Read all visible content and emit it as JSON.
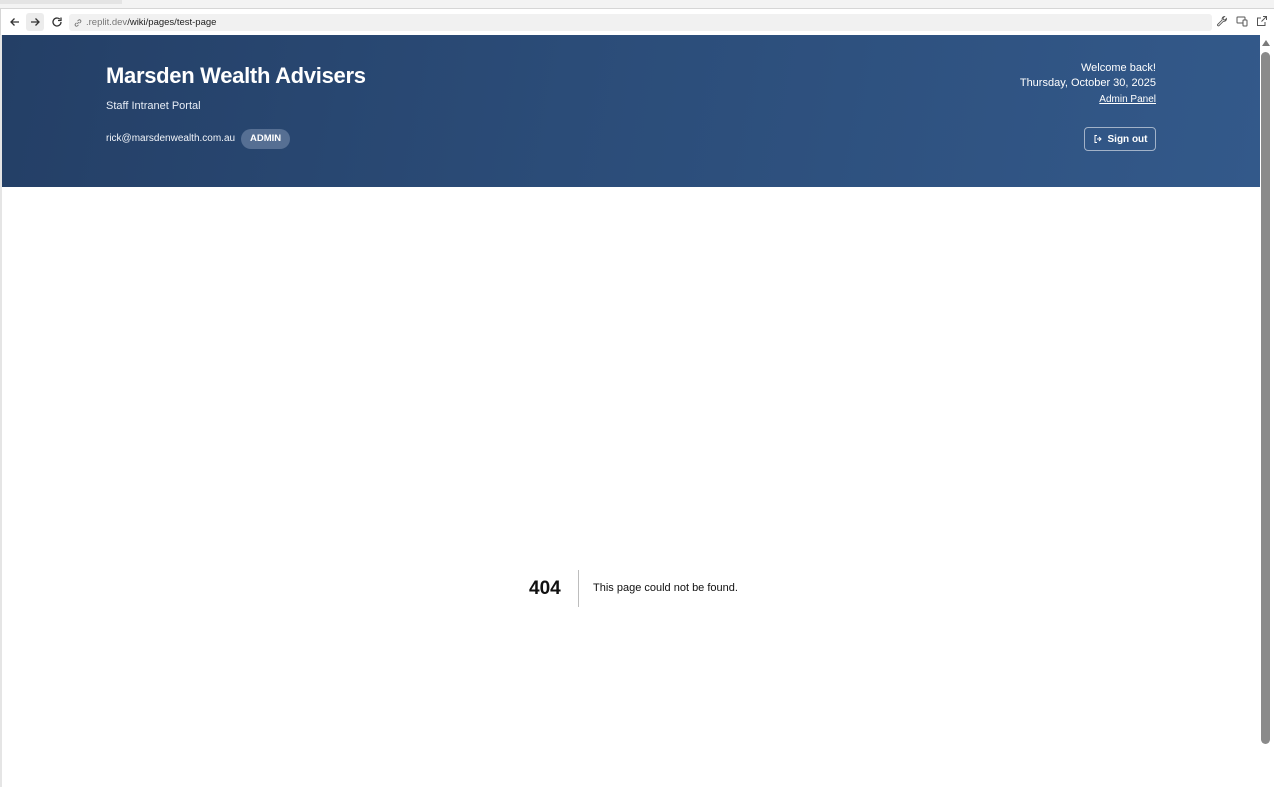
{
  "browser": {
    "url_prefix": ".replit.dev",
    "url_path": "/wiki/pages/test-page",
    "icons": [
      "back-arrow-icon",
      "forward-arrow-icon",
      "reload-icon",
      "link-icon",
      "wrench-icon",
      "devices-icon",
      "external-link-icon"
    ]
  },
  "header": {
    "title": "Marsden Wealth Advisers",
    "subtitle": "Staff Intranet Portal",
    "user_email": "rick@marsdenwealth.com.au",
    "role_badge": "ADMIN",
    "welcome": "Welcome back!",
    "date": "Thursday, October 30, 2025",
    "admin_link": "Admin Panel",
    "signout_label": "Sign out",
    "gradient_colors": [
      "#243f66",
      "#33598a"
    ]
  },
  "not_found": {
    "code": "404",
    "message": "This page could not be found."
  }
}
